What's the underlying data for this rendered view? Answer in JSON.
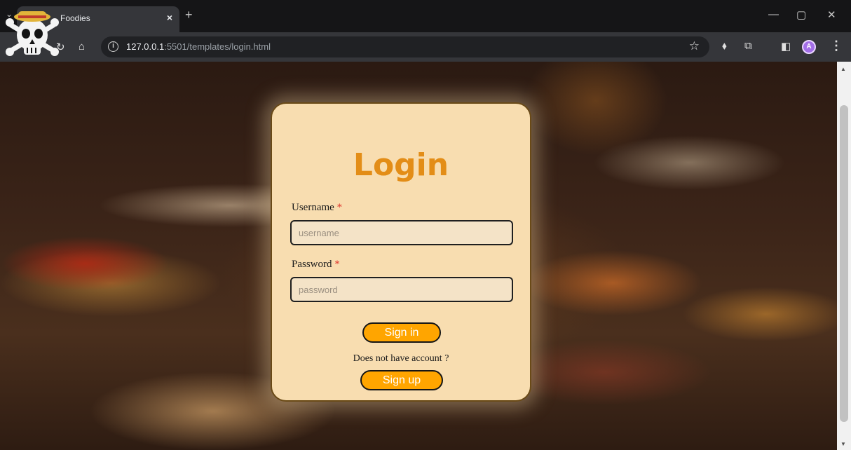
{
  "browser": {
    "tab_title": "Foodies",
    "tab_close": "×",
    "new_tab": "+",
    "url_host": "127.0.0.1",
    "url_path": ":5501/templates/login.html",
    "window_minimize": "—",
    "window_restore": "▢",
    "window_close": "✕",
    "avatar_letter": "A"
  },
  "login": {
    "title": "Login",
    "username_label": "Username",
    "username_placeholder": "username",
    "password_label": "Password",
    "password_placeholder": "password",
    "required_marker": "*",
    "signin_label": "Sign in",
    "signup_prompt": "Does not have account ?",
    "signup_label": "Sign up"
  },
  "colors": {
    "card_bg": "#f8ddb0",
    "title": "#e38d17",
    "button": "#ffa500",
    "required": "#e0362c"
  }
}
